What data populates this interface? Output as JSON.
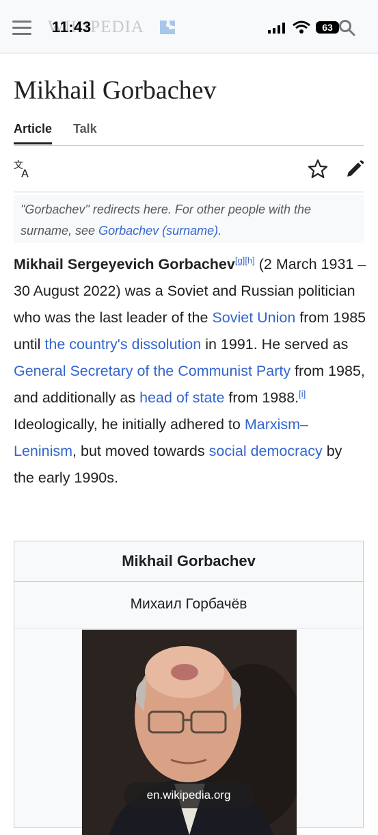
{
  "status_bar": {
    "time": "11:43",
    "battery": "63"
  },
  "header": {
    "logo_text": "WIKIPEDIA"
  },
  "page": {
    "title": "Mikhail Gorbachev",
    "tabs": [
      "Article",
      "Talk"
    ]
  },
  "hatnote": {
    "text_before": "\"Gorbachev\" redirects here. For other people with the surname, see ",
    "link": "Gorbachev (surname)",
    "text_after": "."
  },
  "lead": {
    "bold_name": "Mikhail Sergeyevich Gorbachev",
    "ref1": "[g]",
    "ref2": "[h]",
    "t1": " (2 March 1931 – 30 August 2022) was a Soviet and Russian politician who was the last leader of the ",
    "link1": "Soviet Union",
    "t2": " from 1985 until ",
    "link2": "the country's dissolution",
    "t3": " in 1991. He served as ",
    "link3": "General Secretary of the Communist Party",
    "t4": " from 1985, and additionally as ",
    "link4": "head of state",
    "t5": " from 1988.",
    "ref3": "[i]",
    "t6": " Ideologically, he initially adhered to ",
    "link5": "Marxism–Leninism",
    "t7": ", but moved towards ",
    "link6": "social democracy",
    "t8": " by the early 1990s."
  },
  "infobox": {
    "title": "Mikhail Gorbachev",
    "native_name": "Михаил Горбачёв"
  },
  "url_pill": "en.wikipedia.org",
  "colors": {
    "link": "#3366cc",
    "text": "#202122",
    "muted": "#54595d",
    "bg_header": "#f8f9fa"
  },
  "icons": [
    "menu-icon",
    "search-icon",
    "translate-icon",
    "star-icon",
    "edit-icon",
    "signal-icon",
    "wifi-icon"
  ]
}
